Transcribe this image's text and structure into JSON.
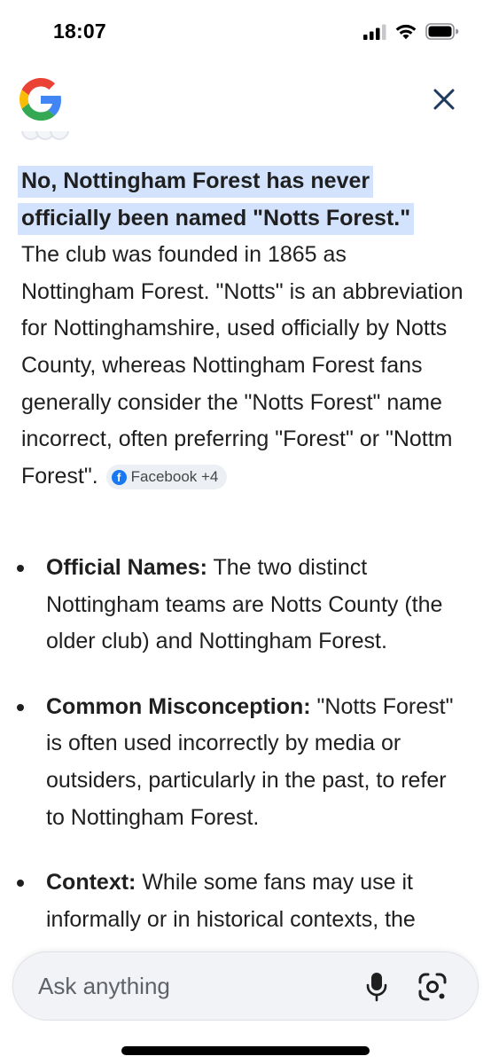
{
  "status_bar": {
    "time": "18:07",
    "icons": [
      "cellular-signal-icon",
      "wifi-icon",
      "battery-icon"
    ]
  },
  "header": {
    "logo": "google-g-logo",
    "close_icon": "close-icon"
  },
  "answer": {
    "highlight_line1": "No, Nottingham Forest has never",
    "highlight_line2": "officially been named \"Notts Forest.\"",
    "body": "The club was founded in 1865 as Nottingham Forest. \"Notts\" is an abbreviation for Nottinghamshire, used officially by Notts County, whereas Nottingham Forest fans generally consider the \"Notts Forest\" name incorrect, often preferring \"Forest\" or \"Nottm Forest\".",
    "source_chip": {
      "icon": "facebook-icon",
      "label": "Facebook +4"
    }
  },
  "bullets": [
    {
      "title": "Official Names:",
      "text": " The two distinct Nottingham teams are Notts County (the older club) and Nottingham Forest."
    },
    {
      "title": "Common Misconception:",
      "text": " \"Notts Forest\" is often used incorrectly by media or outsiders, particularly in the past, to refer to Nottingham Forest."
    },
    {
      "title": "Context:",
      "text": " While some fans may use it informally or in historical contexts, the"
    }
  ],
  "ask_bar": {
    "placeholder": "Ask anything",
    "mic_icon": "microphone-icon",
    "lens_icon": "google-lens-icon"
  },
  "colors": {
    "highlight": "#d3e3fd",
    "text": "#1f1f1f",
    "facebook": "#1877f2",
    "close_icon": "#1f3a5f"
  }
}
